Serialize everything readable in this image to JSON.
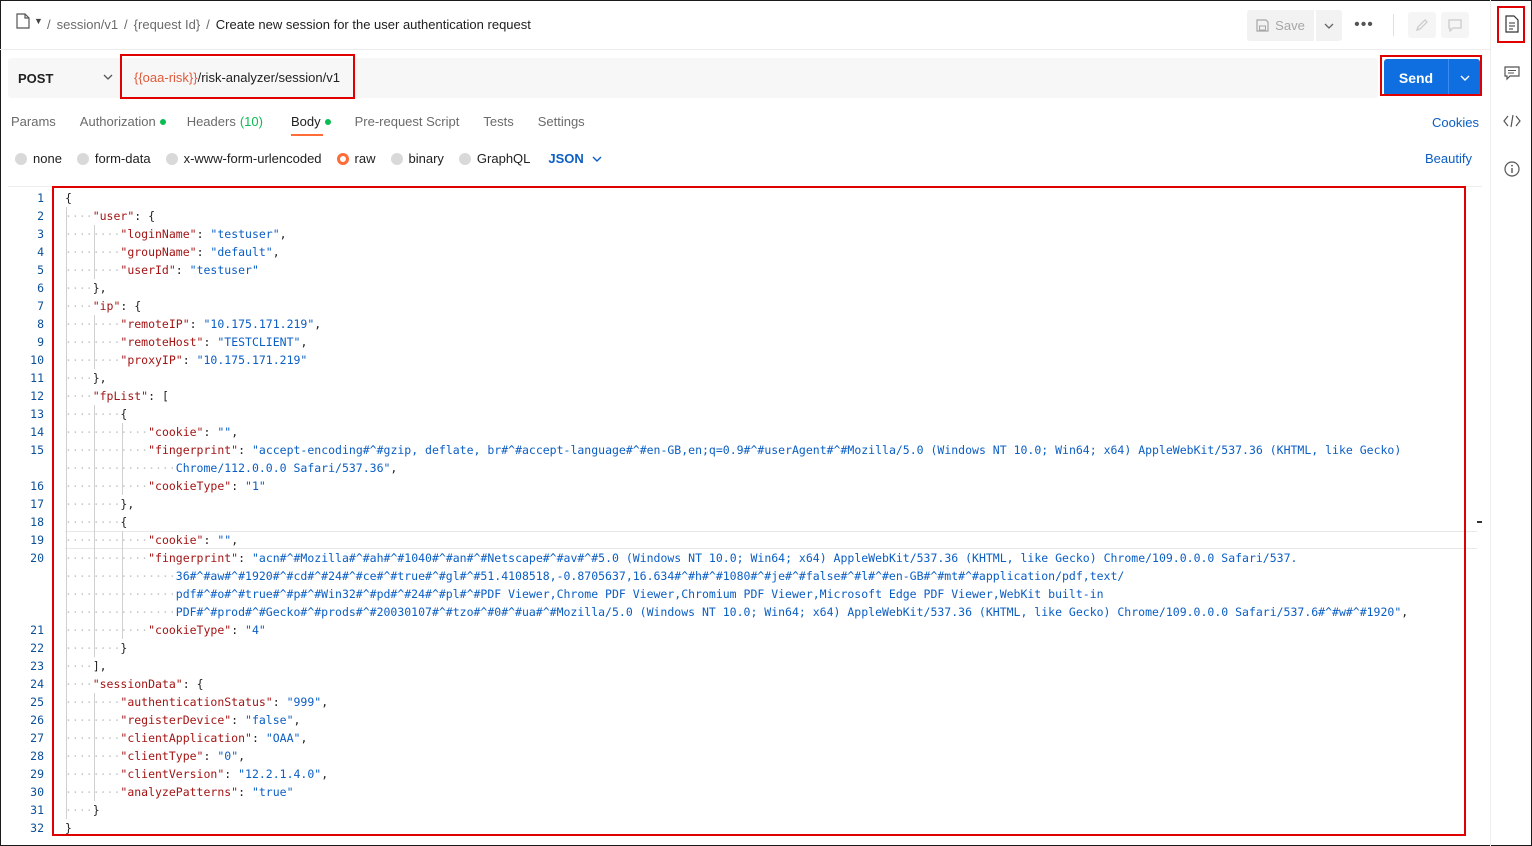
{
  "breadcrumb": {
    "items": [
      "session/v1",
      "{request Id}"
    ],
    "separator": "/",
    "title": "Create new session for the user authentication request"
  },
  "toolbar": {
    "save_label": "Save",
    "more_label": "•••"
  },
  "request": {
    "method": "POST",
    "url_variable": "{{oaa-risk}}",
    "url_path": "/risk-analyzer/session/v1",
    "send_label": "Send"
  },
  "tabs": [
    {
      "label": "Params"
    },
    {
      "label": "Authorization",
      "dot": true
    },
    {
      "label": "Headers",
      "count": "(10)"
    },
    {
      "label": "Body",
      "dot": true,
      "active": true
    },
    {
      "label": "Pre-request Script"
    },
    {
      "label": "Tests"
    },
    {
      "label": "Settings"
    }
  ],
  "cookies_label": "Cookies",
  "body_types": [
    {
      "label": "none"
    },
    {
      "label": "form-data"
    },
    {
      "label": "x-www-form-urlencoded"
    },
    {
      "label": "raw",
      "selected": true
    },
    {
      "label": "binary"
    },
    {
      "label": "GraphQL"
    }
  ],
  "format_select": "JSON",
  "beautify_label": "Beautify",
  "colors": {
    "accent": "#ff6c37",
    "send_blue": "#0f6fe0",
    "link_blue": "#0b5ec4",
    "highlight_red": "#e00000",
    "active_dot_green": "#0cbb52"
  },
  "editor": {
    "lines": [
      {
        "n": "1",
        "indent": 0,
        "tokens": [
          {
            "t": "{"
          }
        ]
      },
      {
        "n": "2",
        "indent": 1,
        "tokens": [
          {
            "k": "\"user\""
          },
          {
            "t": ": {"
          }
        ]
      },
      {
        "n": "3",
        "indent": 2,
        "tokens": [
          {
            "k": "\"loginName\""
          },
          {
            "t": ": "
          },
          {
            "s": "\"testuser\""
          },
          {
            "t": ","
          }
        ]
      },
      {
        "n": "4",
        "indent": 2,
        "tokens": [
          {
            "k": "\"groupName\""
          },
          {
            "t": ": "
          },
          {
            "s": "\"default\""
          },
          {
            "t": ","
          }
        ]
      },
      {
        "n": "5",
        "indent": 2,
        "tokens": [
          {
            "k": "\"userId\""
          },
          {
            "t": ": "
          },
          {
            "s": "\"testuser\""
          }
        ]
      },
      {
        "n": "6",
        "indent": 1,
        "tokens": [
          {
            "t": "},"
          }
        ]
      },
      {
        "n": "7",
        "indent": 1,
        "tokens": [
          {
            "k": "\"ip\""
          },
          {
            "t": ": {"
          }
        ]
      },
      {
        "n": "8",
        "indent": 2,
        "tokens": [
          {
            "k": "\"remoteIP\""
          },
          {
            "t": ": "
          },
          {
            "s": "\"10.175.171.219\""
          },
          {
            "t": ","
          }
        ]
      },
      {
        "n": "9",
        "indent": 2,
        "tokens": [
          {
            "k": "\"remoteHost\""
          },
          {
            "t": ": "
          },
          {
            "s": "\"TESTCLIENT\""
          },
          {
            "t": ","
          }
        ]
      },
      {
        "n": "10",
        "indent": 2,
        "tokens": [
          {
            "k": "\"proxyIP\""
          },
          {
            "t": ": "
          },
          {
            "s": "\"10.175.171.219\""
          }
        ]
      },
      {
        "n": "11",
        "indent": 1,
        "tokens": [
          {
            "t": "},"
          }
        ]
      },
      {
        "n": "12",
        "indent": 1,
        "tokens": [
          {
            "k": "\"fpList\""
          },
          {
            "t": ": ["
          }
        ]
      },
      {
        "n": "13",
        "indent": 2,
        "tokens": [
          {
            "t": "{"
          }
        ]
      },
      {
        "n": "14",
        "indent": 3,
        "tokens": [
          {
            "k": "\"cookie\""
          },
          {
            "t": ": "
          },
          {
            "s": "\"\""
          },
          {
            "t": ","
          }
        ]
      },
      {
        "n": "15",
        "indent": 3,
        "tokens": [
          {
            "k": "\"fingerprint\""
          },
          {
            "t": ": "
          },
          {
            "s": "\"accept-encoding#^#gzip, deflate, br#^#accept-language#^#en-GB,en;q=0.9#^#userAgent#^#Mozilla/5.0 (Windows NT 10.0; Win64; x64) AppleWebKit/537.36 (KHTML, like Gecko)"
          }
        ]
      },
      {
        "n": "",
        "indent": 4,
        "tokens": [
          {
            "s": "Chrome/112.0.0.0 Safari/537.36\""
          },
          {
            "t": ","
          }
        ]
      },
      {
        "n": "16",
        "indent": 3,
        "tokens": [
          {
            "k": "\"cookieType\""
          },
          {
            "t": ": "
          },
          {
            "s": "\"1\""
          }
        ]
      },
      {
        "n": "17",
        "indent": 2,
        "tokens": [
          {
            "t": "},"
          }
        ]
      },
      {
        "n": "18",
        "indent": 2,
        "tokens": [
          {
            "t": "{"
          }
        ]
      },
      {
        "n": "19",
        "indent": 3,
        "tokens": [
          {
            "k": "\"cookie\""
          },
          {
            "t": ": "
          },
          {
            "s": "\"\""
          },
          {
            "t": ","
          }
        ]
      },
      {
        "n": "20",
        "indent": 3,
        "tokens": [
          {
            "k": "\"fingerprint\""
          },
          {
            "t": ": "
          },
          {
            "s": "\"acn#^#Mozilla#^#ah#^#1040#^#an#^#Netscape#^#av#^#5.0 (Windows NT 10.0; Win64; x64) AppleWebKit/537.36 (KHTML, like Gecko) Chrome/109.0.0.0 Safari/537."
          }
        ]
      },
      {
        "n": "",
        "indent": 4,
        "tokens": [
          {
            "s": "36#^#aw#^#1920#^#cd#^#24#^#ce#^#true#^#gl#^#51.4108518,-0.8705637,16.634#^#h#^#1080#^#je#^#false#^#l#^#en-GB#^#mt#^#application/pdf,text/"
          }
        ]
      },
      {
        "n": "",
        "indent": 4,
        "tokens": [
          {
            "s": "pdf#^#o#^#true#^#p#^#Win32#^#pd#^#24#^#pl#^#PDF Viewer,Chrome PDF Viewer,Chromium PDF Viewer,Microsoft Edge PDF Viewer,WebKit built-in"
          }
        ]
      },
      {
        "n": "",
        "indent": 4,
        "tokens": [
          {
            "s": "PDF#^#prod#^#Gecko#^#prods#^#20030107#^#tzo#^#0#^#ua#^#Mozilla/5.0 (Windows NT 10.0; Win64; x64) AppleWebKit/537.36 (KHTML, like Gecko) Chrome/109.0.0.0 Safari/537.6#^#w#^#1920\""
          },
          {
            "t": ","
          }
        ]
      },
      {
        "n": "21",
        "indent": 3,
        "tokens": [
          {
            "k": "\"cookieType\""
          },
          {
            "t": ": "
          },
          {
            "s": "\"4\""
          }
        ]
      },
      {
        "n": "22",
        "indent": 2,
        "tokens": [
          {
            "t": "}"
          }
        ]
      },
      {
        "n": "23",
        "indent": 1,
        "tokens": [
          {
            "t": "],"
          }
        ]
      },
      {
        "n": "24",
        "indent": 1,
        "tokens": [
          {
            "k": "\"sessionData\""
          },
          {
            "t": ": {"
          }
        ]
      },
      {
        "n": "25",
        "indent": 2,
        "tokens": [
          {
            "k": "\"authenticationStatus\""
          },
          {
            "t": ": "
          },
          {
            "s": "\"999\""
          },
          {
            "t": ","
          }
        ]
      },
      {
        "n": "26",
        "indent": 2,
        "tokens": [
          {
            "k": "\"registerDevice\""
          },
          {
            "t": ": "
          },
          {
            "s": "\"false\""
          },
          {
            "t": ","
          }
        ]
      },
      {
        "n": "27",
        "indent": 2,
        "tokens": [
          {
            "k": "\"clientApplication\""
          },
          {
            "t": ": "
          },
          {
            "s": "\"OAA\""
          },
          {
            "t": ","
          }
        ]
      },
      {
        "n": "28",
        "indent": 2,
        "tokens": [
          {
            "k": "\"clientType\""
          },
          {
            "t": ": "
          },
          {
            "s": "\"0\""
          },
          {
            "t": ","
          }
        ]
      },
      {
        "n": "29",
        "indent": 2,
        "tokens": [
          {
            "k": "\"clientVersion\""
          },
          {
            "t": ": "
          },
          {
            "s": "\"12.2.1.4.0\""
          },
          {
            "t": ","
          }
        ]
      },
      {
        "n": "30",
        "indent": 2,
        "tokens": [
          {
            "k": "\"analyzePatterns\""
          },
          {
            "t": ": "
          },
          {
            "s": "\"true\""
          }
        ]
      },
      {
        "n": "31",
        "indent": 1,
        "tokens": [
          {
            "t": "}"
          }
        ]
      },
      {
        "n": "32",
        "indent": 0,
        "tokens": [
          {
            "t": "}"
          }
        ]
      }
    ]
  }
}
